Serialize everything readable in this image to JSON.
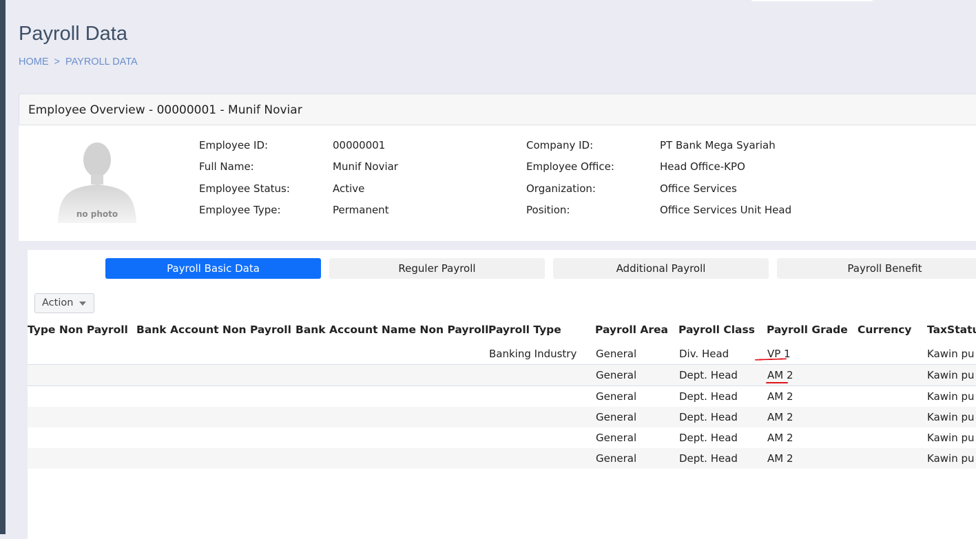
{
  "header": {
    "title": "Payroll Data"
  },
  "breadcrumb": {
    "home": "HOME",
    "separator": ">",
    "current": "PAYROLL DATA"
  },
  "overview": {
    "title": "Employee Overview - 00000001 - Munif Noviar",
    "photo_text": "no photo",
    "left_fields": [
      {
        "label": "Employee ID:",
        "value": "00000001"
      },
      {
        "label": "Full Name:",
        "value": "Munif Noviar"
      },
      {
        "label": "Employee Status:",
        "value": "Active"
      },
      {
        "label": "Employee Type:",
        "value": "Permanent"
      }
    ],
    "right_fields": [
      {
        "label": "Company ID:",
        "value": "PT Bank Mega Syariah"
      },
      {
        "label": "Employee Office:",
        "value": "Head Office-KPO"
      },
      {
        "label": "Organization:",
        "value": "Office Services"
      },
      {
        "label": "Position:",
        "value": "Office Services Unit Head"
      }
    ]
  },
  "tabs": [
    {
      "label": "Payroll Basic Data",
      "active": true
    },
    {
      "label": "Reguler Payroll",
      "active": false
    },
    {
      "label": "Additional Payroll",
      "active": false
    },
    {
      "label": "Payroll Benefit",
      "active": false
    }
  ],
  "toolbar": {
    "action_label": "Action"
  },
  "table": {
    "columns": [
      "Type Non Payroll",
      "Bank Account Non Payroll",
      "Bank Account Name Non Payroll",
      "Payroll Type",
      "Payroll Area",
      "Payroll Class",
      "Payroll Grade",
      "Currency",
      "TaxStatus"
    ],
    "rows": [
      [
        "",
        "",
        "",
        "Banking Industry",
        "General",
        "Div. Head",
        "VP 1",
        "",
        "Kawin pu"
      ],
      [
        "",
        "",
        "",
        "",
        "General",
        "Dept. Head",
        "AM 2",
        "",
        "Kawin pu"
      ],
      [
        "",
        "",
        "",
        "",
        "General",
        "Dept. Head",
        "AM 2",
        "",
        "Kawin pu"
      ],
      [
        "",
        "",
        "",
        "",
        "General",
        "Dept. Head",
        "AM 2",
        "",
        "Kawin pu"
      ],
      [
        "",
        "",
        "",
        "",
        "General",
        "Dept. Head",
        "AM 2",
        "",
        "Kawin pu"
      ],
      [
        "",
        "",
        "",
        "",
        "General",
        "Dept. Head",
        "AM 2",
        "",
        "Kawin pu"
      ]
    ]
  },
  "colors": {
    "accent": "#0f6ffb",
    "annotation": "#e0141c",
    "breadcrumb": "#6b8fcc"
  },
  "icons": {
    "avatar": "user-silhouette-icon",
    "dropdown": "caret-down-icon"
  }
}
